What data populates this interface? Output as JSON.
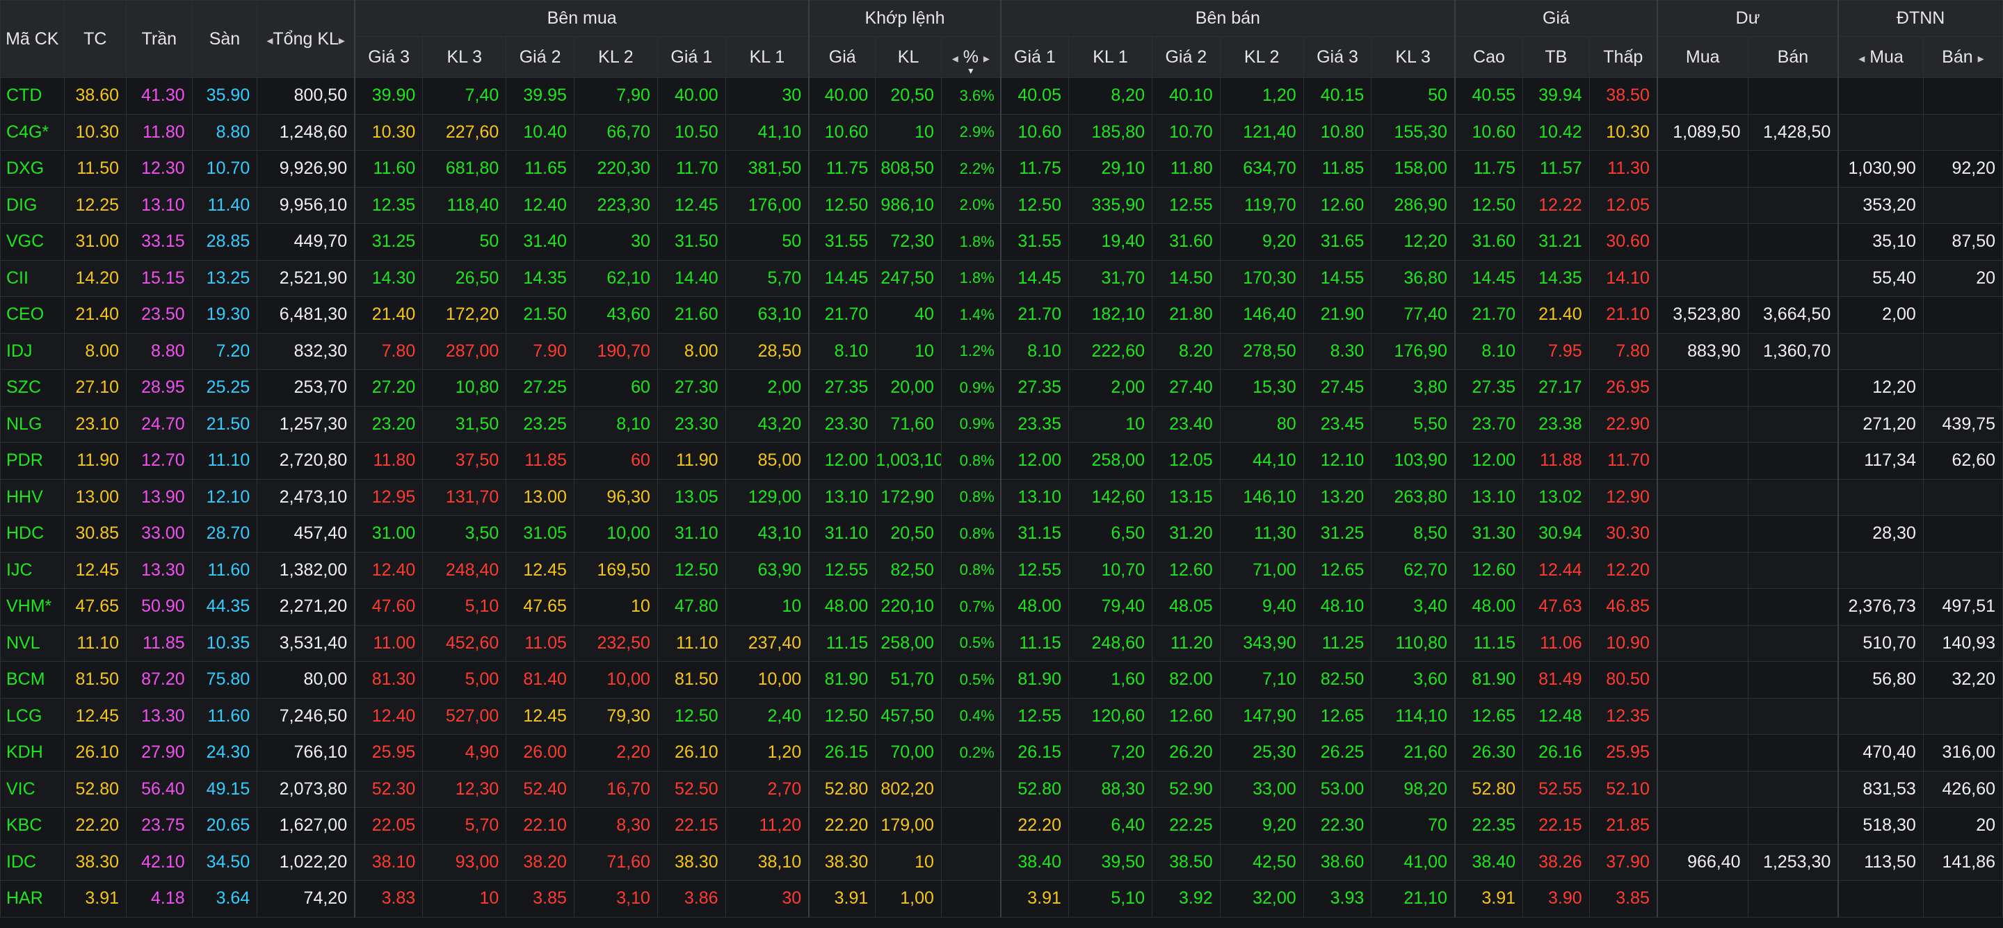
{
  "headers": {
    "symbol": "Mã CK",
    "ref": "TC",
    "ceil": "Trần",
    "floor": "Sàn",
    "total_vol": "Tổng KL",
    "bid_group": "Bên mua",
    "match_group": "Khớp lệnh",
    "ask_group": "Bên bán",
    "price_group": "Giá",
    "residual_group": "Dư",
    "foreign_group": "ĐTNN",
    "bid_cols": [
      "Giá 3",
      "KL 3",
      "Giá 2",
      "KL 2",
      "Giá 1",
      "KL 1"
    ],
    "match_cols": [
      "Giá",
      "KL",
      "%"
    ],
    "ask_cols": [
      "Giá 1",
      "KL 1",
      "Giá 2",
      "KL 2",
      "Giá 3",
      "KL 3"
    ],
    "price_cols": [
      "Cao",
      "TB",
      "Thấp"
    ],
    "residual_cols": [
      "Mua",
      "Bán"
    ],
    "foreign_cols": [
      "Mua",
      "Bán"
    ]
  },
  "colors": {
    "up": "#1ee61e",
    "ref": "#f5c518",
    "down": "#ff3b30",
    "ceil": "#f050f0",
    "floor": "#33ccff",
    "neutral": "#f0f0f0",
    "background": "#121417",
    "header_bg": "#25272b"
  },
  "rows": [
    [
      "CTD",
      "u",
      "38.60",
      "41.30",
      "35.90",
      "800,50",
      "39.90",
      "u",
      "7,40",
      "u",
      "39.95",
      "u",
      "7,90",
      "u",
      "40.00",
      "u",
      "30",
      "u",
      "40.00",
      "u",
      "20,50",
      "u",
      "3.6%",
      "u",
      "40.05",
      "u",
      "8,20",
      "u",
      "40.10",
      "u",
      "1,20",
      "u",
      "40.15",
      "u",
      "50",
      "u",
      "40.55",
      "u",
      "39.94",
      "u",
      "38.50",
      "d",
      "",
      "",
      "",
      ""
    ],
    [
      "C4G*",
      "u",
      "10.30",
      "11.80",
      "8.80",
      "1,248,60",
      "10.30",
      "r",
      "227,60",
      "r",
      "10.40",
      "u",
      "66,70",
      "u",
      "10.50",
      "u",
      "41,10",
      "u",
      "10.60",
      "u",
      "10",
      "u",
      "2.9%",
      "u",
      "10.60",
      "u",
      "185,80",
      "u",
      "10.70",
      "u",
      "121,40",
      "u",
      "10.80",
      "u",
      "155,30",
      "u",
      "10.60",
      "u",
      "10.42",
      "u",
      "10.30",
      "r",
      "1,089,50",
      "1,428,50",
      "",
      ""
    ],
    [
      "DXG",
      "u",
      "11.50",
      "12.30",
      "10.70",
      "9,926,90",
      "11.60",
      "u",
      "681,80",
      "u",
      "11.65",
      "u",
      "220,30",
      "u",
      "11.70",
      "u",
      "381,50",
      "u",
      "11.75",
      "u",
      "808,50",
      "u",
      "2.2%",
      "u",
      "11.75",
      "u",
      "29,10",
      "u",
      "11.80",
      "u",
      "634,70",
      "u",
      "11.85",
      "u",
      "158,00",
      "u",
      "11.75",
      "u",
      "11.57",
      "u",
      "11.30",
      "d",
      "",
      "",
      "1,030,90",
      "92,20"
    ],
    [
      "DIG",
      "u",
      "12.25",
      "13.10",
      "11.40",
      "9,956,10",
      "12.35",
      "u",
      "118,40",
      "u",
      "12.40",
      "u",
      "223,30",
      "u",
      "12.45",
      "u",
      "176,00",
      "u",
      "12.50",
      "u",
      "986,10",
      "u",
      "2.0%",
      "u",
      "12.50",
      "u",
      "335,90",
      "u",
      "12.55",
      "u",
      "119,70",
      "u",
      "12.60",
      "u",
      "286,90",
      "u",
      "12.50",
      "u",
      "12.22",
      "d",
      "12.05",
      "d",
      "",
      "",
      "353,20",
      ""
    ],
    [
      "VGC",
      "u",
      "31.00",
      "33.15",
      "28.85",
      "449,70",
      "31.25",
      "u",
      "50",
      "u",
      "31.40",
      "u",
      "30",
      "u",
      "31.50",
      "u",
      "50",
      "u",
      "31.55",
      "u",
      "72,30",
      "u",
      "1.8%",
      "u",
      "31.55",
      "u",
      "19,40",
      "u",
      "31.60",
      "u",
      "9,20",
      "u",
      "31.65",
      "u",
      "12,20",
      "u",
      "31.60",
      "u",
      "31.21",
      "u",
      "30.60",
      "d",
      "",
      "",
      "35,10",
      "87,50"
    ],
    [
      "CII",
      "u",
      "14.20",
      "15.15",
      "13.25",
      "2,521,90",
      "14.30",
      "u",
      "26,50",
      "u",
      "14.35",
      "u",
      "62,10",
      "u",
      "14.40",
      "u",
      "5,70",
      "u",
      "14.45",
      "u",
      "247,50",
      "u",
      "1.8%",
      "u",
      "14.45",
      "u",
      "31,70",
      "u",
      "14.50",
      "u",
      "170,30",
      "u",
      "14.55",
      "u",
      "36,80",
      "u",
      "14.45",
      "u",
      "14.35",
      "u",
      "14.10",
      "d",
      "",
      "",
      "55,40",
      "20"
    ],
    [
      "CEO",
      "u",
      "21.40",
      "23.50",
      "19.30",
      "6,481,30",
      "21.40",
      "r",
      "172,20",
      "r",
      "21.50",
      "u",
      "43,60",
      "u",
      "21.60",
      "u",
      "63,10",
      "u",
      "21.70",
      "u",
      "40",
      "u",
      "1.4%",
      "u",
      "21.70",
      "u",
      "182,10",
      "u",
      "21.80",
      "u",
      "146,40",
      "u",
      "21.90",
      "u",
      "77,40",
      "u",
      "21.70",
      "u",
      "21.40",
      "r",
      "21.10",
      "d",
      "3,523,80",
      "3,664,50",
      "2,00",
      ""
    ],
    [
      "IDJ",
      "u",
      "8.00",
      "8.80",
      "7.20",
      "832,30",
      "7.80",
      "d",
      "287,00",
      "d",
      "7.90",
      "d",
      "190,70",
      "d",
      "8.00",
      "r",
      "28,50",
      "r",
      "8.10",
      "u",
      "10",
      "u",
      "1.2%",
      "u",
      "8.10",
      "u",
      "222,60",
      "u",
      "8.20",
      "u",
      "278,50",
      "u",
      "8.30",
      "u",
      "176,90",
      "u",
      "8.10",
      "u",
      "7.95",
      "d",
      "7.80",
      "d",
      "883,90",
      "1,360,70",
      "",
      ""
    ],
    [
      "SZC",
      "u",
      "27.10",
      "28.95",
      "25.25",
      "253,70",
      "27.20",
      "u",
      "10,80",
      "u",
      "27.25",
      "u",
      "60",
      "u",
      "27.30",
      "u",
      "2,00",
      "u",
      "27.35",
      "u",
      "20,00",
      "u",
      "0.9%",
      "u",
      "27.35",
      "u",
      "2,00",
      "u",
      "27.40",
      "u",
      "15,30",
      "u",
      "27.45",
      "u",
      "3,80",
      "u",
      "27.35",
      "u",
      "27.17",
      "u",
      "26.95",
      "d",
      "",
      "",
      "12,20",
      ""
    ],
    [
      "NLG",
      "u",
      "23.10",
      "24.70",
      "21.50",
      "1,257,30",
      "23.20",
      "u",
      "31,50",
      "u",
      "23.25",
      "u",
      "8,10",
      "u",
      "23.30",
      "u",
      "43,20",
      "u",
      "23.30",
      "u",
      "71,60",
      "u",
      "0.9%",
      "u",
      "23.35",
      "u",
      "10",
      "u",
      "23.40",
      "u",
      "80",
      "u",
      "23.45",
      "u",
      "5,50",
      "u",
      "23.70",
      "u",
      "23.38",
      "u",
      "22.90",
      "d",
      "",
      "",
      "271,20",
      "439,75"
    ],
    [
      "PDR",
      "u",
      "11.90",
      "12.70",
      "11.10",
      "2,720,80",
      "11.80",
      "d",
      "37,50",
      "d",
      "11.85",
      "d",
      "60",
      "d",
      "11.90",
      "r",
      "85,00",
      "r",
      "12.00",
      "u",
      "1,003,10",
      "u",
      "0.8%",
      "u",
      "12.00",
      "u",
      "258,00",
      "u",
      "12.05",
      "u",
      "44,10",
      "u",
      "12.10",
      "u",
      "103,90",
      "u",
      "12.00",
      "u",
      "11.88",
      "d",
      "11.70",
      "d",
      "",
      "",
      "117,34",
      "62,60"
    ],
    [
      "HHV",
      "u",
      "13.00",
      "13.90",
      "12.10",
      "2,473,10",
      "12.95",
      "d",
      "131,70",
      "d",
      "13.00",
      "r",
      "96,30",
      "r",
      "13.05",
      "u",
      "129,00",
      "u",
      "13.10",
      "u",
      "172,90",
      "u",
      "0.8%",
      "u",
      "13.10",
      "u",
      "142,60",
      "u",
      "13.15",
      "u",
      "146,10",
      "u",
      "13.20",
      "u",
      "263,80",
      "u",
      "13.10",
      "u",
      "13.02",
      "u",
      "12.90",
      "d",
      "",
      "",
      "",
      ""
    ],
    [
      "HDC",
      "u",
      "30.85",
      "33.00",
      "28.70",
      "457,40",
      "31.00",
      "u",
      "3,50",
      "u",
      "31.05",
      "u",
      "10,00",
      "u",
      "31.10",
      "u",
      "43,10",
      "u",
      "31.10",
      "u",
      "20,50",
      "u",
      "0.8%",
      "u",
      "31.15",
      "u",
      "6,50",
      "u",
      "31.20",
      "u",
      "11,30",
      "u",
      "31.25",
      "u",
      "8,50",
      "u",
      "31.30",
      "u",
      "30.94",
      "u",
      "30.30",
      "d",
      "",
      "",
      "28,30",
      ""
    ],
    [
      "IJC",
      "u",
      "12.45",
      "13.30",
      "11.60",
      "1,382,00",
      "12.40",
      "d",
      "248,40",
      "d",
      "12.45",
      "r",
      "169,50",
      "r",
      "12.50",
      "u",
      "63,90",
      "u",
      "12.55",
      "u",
      "82,50",
      "u",
      "0.8%",
      "u",
      "12.55",
      "u",
      "10,70",
      "u",
      "12.60",
      "u",
      "71,00",
      "u",
      "12.65",
      "u",
      "62,70",
      "u",
      "12.60",
      "u",
      "12.44",
      "d",
      "12.20",
      "d",
      "",
      "",
      "",
      ""
    ],
    [
      "VHM*",
      "u",
      "47.65",
      "50.90",
      "44.35",
      "2,271,20",
      "47.60",
      "d",
      "5,10",
      "d",
      "47.65",
      "r",
      "10",
      "r",
      "47.80",
      "u",
      "10",
      "u",
      "48.00",
      "u",
      "220,10",
      "u",
      "0.7%",
      "u",
      "48.00",
      "u",
      "79,40",
      "u",
      "48.05",
      "u",
      "9,40",
      "u",
      "48.10",
      "u",
      "3,40",
      "u",
      "48.00",
      "u",
      "47.63",
      "d",
      "46.85",
      "d",
      "",
      "",
      "2,376,73",
      "497,51"
    ],
    [
      "NVL",
      "u",
      "11.10",
      "11.85",
      "10.35",
      "3,531,40",
      "11.00",
      "d",
      "452,60",
      "d",
      "11.05",
      "d",
      "232,50",
      "d",
      "11.10",
      "r",
      "237,40",
      "r",
      "11.15",
      "u",
      "258,00",
      "u",
      "0.5%",
      "u",
      "11.15",
      "u",
      "248,60",
      "u",
      "11.20",
      "u",
      "343,90",
      "u",
      "11.25",
      "u",
      "110,80",
      "u",
      "11.15",
      "u",
      "11.06",
      "d",
      "10.90",
      "d",
      "",
      "",
      "510,70",
      "140,93"
    ],
    [
      "BCM",
      "u",
      "81.50",
      "87.20",
      "75.80",
      "80,00",
      "81.30",
      "d",
      "5,00",
      "d",
      "81.40",
      "d",
      "10,00",
      "d",
      "81.50",
      "r",
      "10,00",
      "r",
      "81.90",
      "u",
      "51,70",
      "u",
      "0.5%",
      "u",
      "81.90",
      "u",
      "1,60",
      "u",
      "82.00",
      "u",
      "7,10",
      "u",
      "82.50",
      "u",
      "3,60",
      "u",
      "81.90",
      "u",
      "81.49",
      "d",
      "80.50",
      "d",
      "",
      "",
      "56,80",
      "32,20"
    ],
    [
      "LCG",
      "u",
      "12.45",
      "13.30",
      "11.60",
      "7,246,50",
      "12.40",
      "d",
      "527,00",
      "d",
      "12.45",
      "r",
      "79,30",
      "r",
      "12.50",
      "u",
      "2,40",
      "u",
      "12.50",
      "u",
      "457,50",
      "u",
      "0.4%",
      "u",
      "12.55",
      "u",
      "120,60",
      "u",
      "12.60",
      "u",
      "147,90",
      "u",
      "12.65",
      "u",
      "114,10",
      "u",
      "12.65",
      "u",
      "12.48",
      "u",
      "12.35",
      "d",
      "",
      "",
      "",
      ""
    ],
    [
      "KDH",
      "u",
      "26.10",
      "27.90",
      "24.30",
      "766,10",
      "25.95",
      "d",
      "4,90",
      "d",
      "26.00",
      "d",
      "2,20",
      "d",
      "26.10",
      "r",
      "1,20",
      "r",
      "26.15",
      "u",
      "70,00",
      "u",
      "0.2%",
      "u",
      "26.15",
      "u",
      "7,20",
      "u",
      "26.20",
      "u",
      "25,30",
      "u",
      "26.25",
      "u",
      "21,60",
      "u",
      "26.30",
      "u",
      "26.16",
      "u",
      "25.95",
      "d",
      "",
      "",
      "470,40",
      "316,00"
    ],
    [
      "VIC",
      "u",
      "52.80",
      "56.40",
      "49.15",
      "2,073,80",
      "52.30",
      "d",
      "12,30",
      "d",
      "52.40",
      "d",
      "16,70",
      "d",
      "52.50",
      "d",
      "2,70",
      "d",
      "52.80",
      "r",
      "802,20",
      "r",
      "",
      "r",
      "52.80",
      "u",
      "88,30",
      "u",
      "52.90",
      "u",
      "33,00",
      "u",
      "53.00",
      "u",
      "98,20",
      "u",
      "52.80",
      "r",
      "52.55",
      "d",
      "52.10",
      "d",
      "",
      "",
      "831,53",
      "426,60"
    ],
    [
      "KBC",
      "u",
      "22.20",
      "23.75",
      "20.65",
      "1,627,00",
      "22.05",
      "d",
      "5,70",
      "d",
      "22.10",
      "d",
      "8,30",
      "d",
      "22.15",
      "d",
      "11,20",
      "d",
      "22.20",
      "r",
      "179,00",
      "r",
      "",
      "r",
      "22.20",
      "r",
      "6,40",
      "u",
      "22.25",
      "u",
      "9,20",
      "u",
      "22.30",
      "u",
      "70",
      "u",
      "22.35",
      "u",
      "22.15",
      "d",
      "21.85",
      "d",
      "",
      "",
      "518,30",
      "20"
    ],
    [
      "IDC",
      "u",
      "38.30",
      "42.10",
      "34.50",
      "1,022,20",
      "38.10",
      "d",
      "93,00",
      "d",
      "38.20",
      "d",
      "71,60",
      "d",
      "38.30",
      "r",
      "38,10",
      "r",
      "38.30",
      "r",
      "10",
      "r",
      "",
      "r",
      "38.40",
      "u",
      "39,50",
      "u",
      "38.50",
      "u",
      "42,50",
      "u",
      "38.60",
      "u",
      "41,00",
      "u",
      "38.40",
      "u",
      "38.26",
      "d",
      "37.90",
      "d",
      "966,40",
      "1,253,30",
      "113,50",
      "141,86"
    ],
    [
      "HAR",
      "u",
      "3.91",
      "4.18",
      "3.64",
      "74,20",
      "3.83",
      "d",
      "10",
      "d",
      "3.85",
      "d",
      "3,10",
      "d",
      "3.86",
      "d",
      "30",
      "d",
      "3.91",
      "r",
      "1,00",
      "r",
      "",
      "r",
      "3.91",
      "r",
      "5,10",
      "u",
      "3.92",
      "u",
      "32,00",
      "u",
      "3.93",
      "u",
      "21,10",
      "u",
      "3.91",
      "r",
      "3.90",
      "d",
      "3.85",
      "d",
      "",
      "",
      "",
      ""
    ]
  ]
}
